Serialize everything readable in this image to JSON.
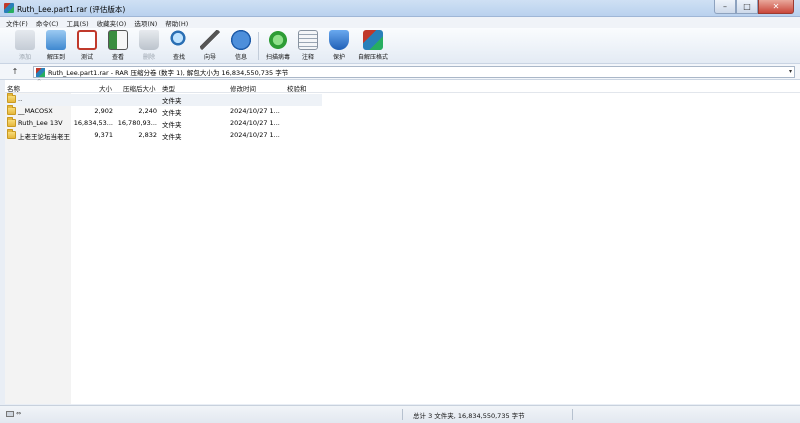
{
  "window": {
    "title": "Ruth_Lee.part1.rar (评估版本)",
    "min_glyph": "–",
    "max_glyph": "□",
    "close_glyph": "✕"
  },
  "menu": [
    "文件(F)",
    "命令(C)",
    "工具(S)",
    "收藏夹(O)",
    "选项(N)",
    "帮助(H)"
  ],
  "toolbar": [
    {
      "label": "添加",
      "icon": "add-icon",
      "disabled": true
    },
    {
      "label": "解压到",
      "icon": "extract-icon",
      "disabled": false
    },
    {
      "label": "测试",
      "icon": "test-icon",
      "disabled": false
    },
    {
      "label": "查看",
      "icon": "view-icon",
      "disabled": false
    },
    {
      "label": "删除",
      "icon": "delete-icon",
      "disabled": true
    },
    {
      "label": "查找",
      "icon": "find-icon",
      "disabled": false
    },
    {
      "label": "向导",
      "icon": "wizard-icon",
      "disabled": false
    },
    {
      "label": "信息",
      "icon": "info-icon",
      "disabled": false
    },
    {
      "label": "扫描病毒",
      "icon": "virus-scan-icon",
      "disabled": false
    },
    {
      "label": "注释",
      "icon": "comment-icon",
      "disabled": false
    },
    {
      "label": "保护",
      "icon": "protect-icon",
      "disabled": false
    },
    {
      "label": "自解压格式",
      "icon": "sfx-icon",
      "disabled": false
    }
  ],
  "address": {
    "up_glyph": "↑",
    "text": "Ruth_Lee.part1.rar - RAR 压缩分卷 (数字 1), 解包大小为 16,834,550,735 字节",
    "dropdown_glyph": "▾"
  },
  "columns": {
    "name": "名称",
    "size": "大小",
    "packed": "压缩后大小",
    "type": "类型",
    "modified": "修改时间",
    "crc": "校验和",
    "sort_glyph": "^"
  },
  "files": [
    {
      "name": "..",
      "size": "",
      "packed": "",
      "type": "文件夹",
      "modified": ""
    },
    {
      "name": "__MACOSX",
      "size": "2,902",
      "packed": "2,240",
      "type": "文件夹",
      "modified": "2024/10/27 1..."
    },
    {
      "name": "Ruth_Lee 13V",
      "size": "16,834,53...",
      "packed": "16,780,93...",
      "type": "文件夹",
      "modified": "2024/10/27 1..."
    },
    {
      "name": "上老王论坛当老王",
      "size": "9,371",
      "packed": "2,832",
      "type": "文件夹",
      "modified": "2024/10/27 1..."
    }
  ],
  "status": {
    "arrow_glyph": "⇔",
    "summary": "总计 3 文件夹, 16,834,550,735 字节"
  },
  "colors": {
    "titlebar": "#cfe0f4",
    "selection": "#eef2f7",
    "folder": "#e5b73b"
  }
}
